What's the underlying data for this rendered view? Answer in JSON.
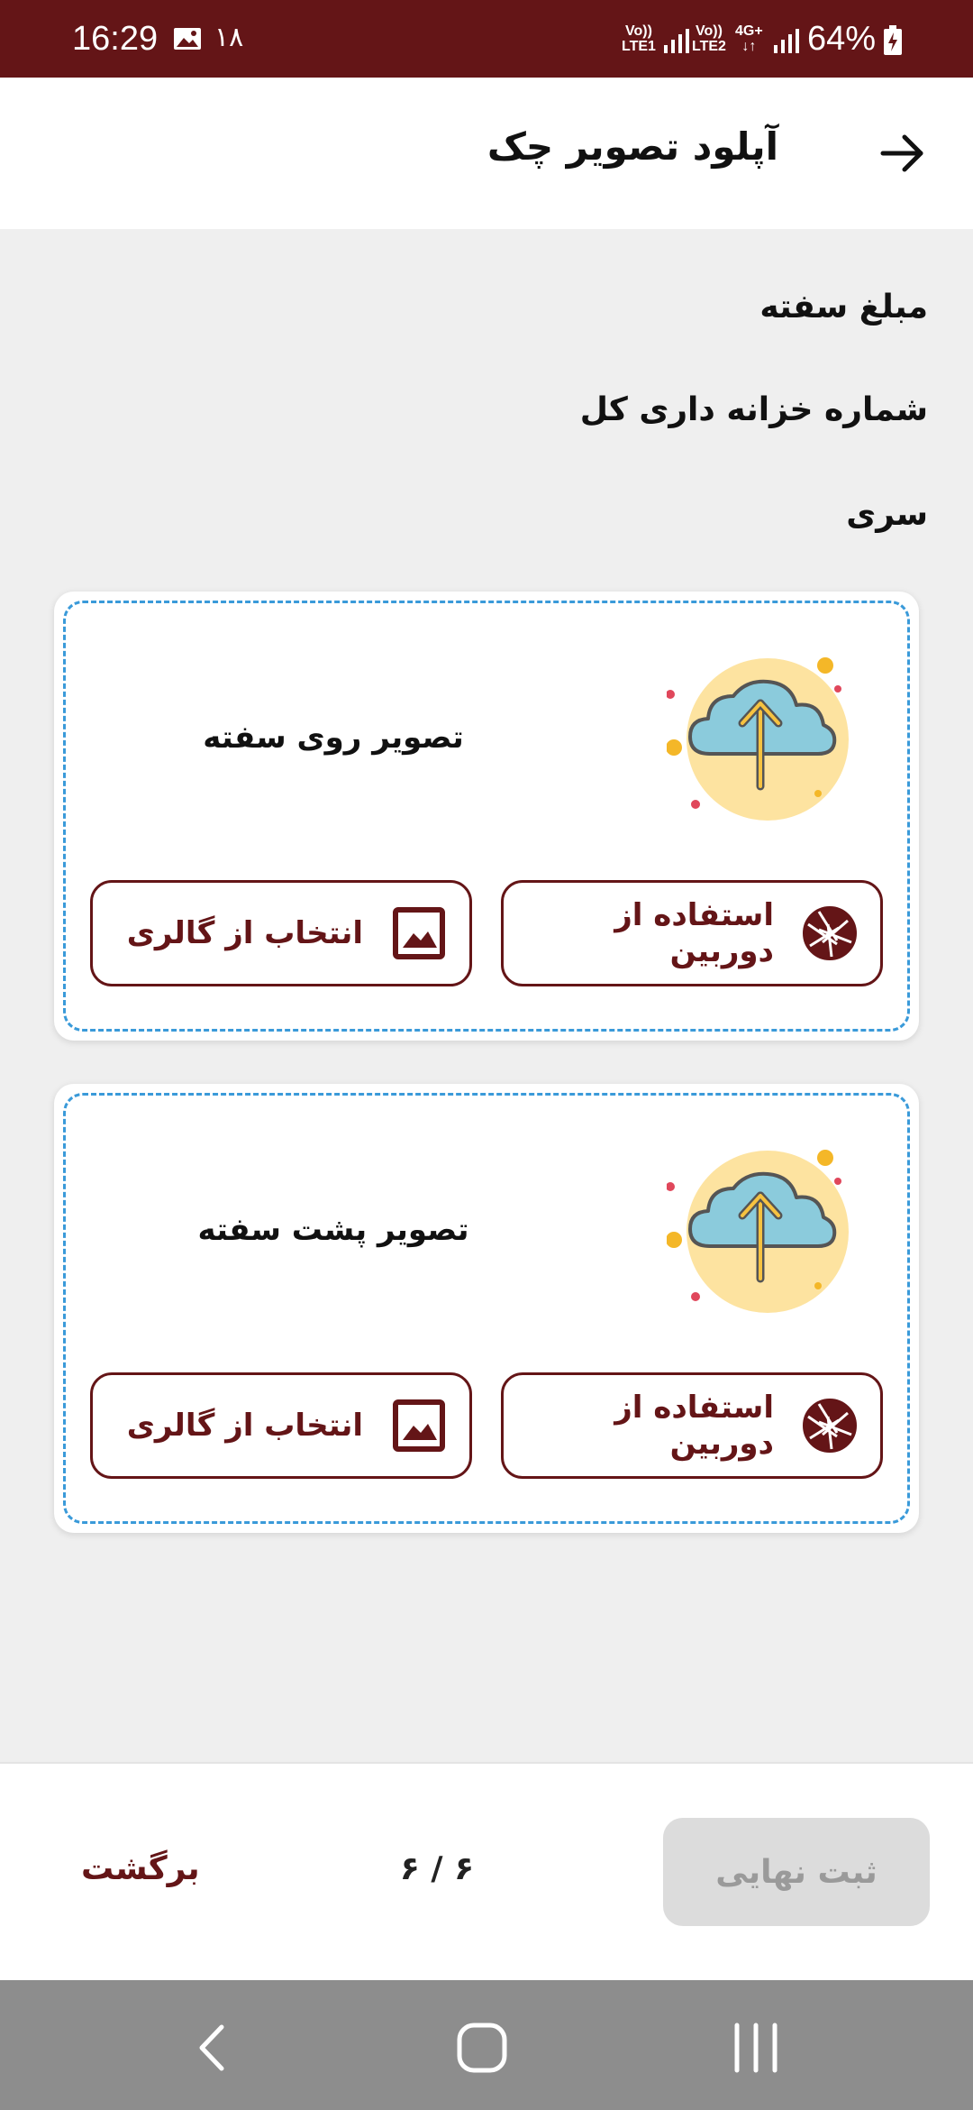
{
  "status_bar": {
    "time": "16:29",
    "notification_count": "۱۸",
    "sim1": {
      "line1": "Vo))",
      "line2": "LTE1"
    },
    "sim2": {
      "line1": "Vo))",
      "line2": "LTE2"
    },
    "network": "4G+",
    "battery": "64%"
  },
  "header": {
    "title": "آپلود تصویر چک",
    "back_icon": "arrow-right-icon"
  },
  "info": {
    "amount_label": "مبلغ سفته",
    "treasury_label": "شماره خزانه داری کل",
    "series_label": "سری"
  },
  "cards": [
    {
      "title": "تصویر روی سفته",
      "camera_label": "استفاده از دوربین",
      "gallery_label": "انتخاب از گالری"
    },
    {
      "title": "تصویر پشت سفته",
      "camera_label": "استفاده از دوربین",
      "gallery_label": "انتخاب از گالری"
    }
  ],
  "footer": {
    "submit_label": "ثبت نهایی",
    "page_indicator": "۶ / ۶",
    "back_label": "برگشت"
  },
  "colors": {
    "brand": "#641517",
    "dashed_border": "#3a9ad9",
    "disabled_button": "#dcdcdc",
    "disabled_text": "#9a9a9a",
    "nav_bar": "#8d8d8d"
  }
}
